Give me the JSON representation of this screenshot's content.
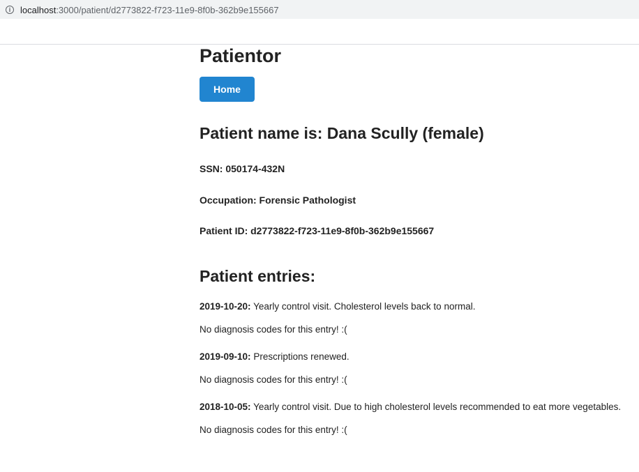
{
  "browser": {
    "url_host": "localhost",
    "url_path": ":3000/patient/d2773822-f723-11e9-8f0b-362b9e155667",
    "info_icon": "info-icon"
  },
  "app": {
    "title": "Patientor",
    "home_button": "Home",
    "accent_color": "#2185d0"
  },
  "patient": {
    "heading": "Patient name is: Dana Scully (female)",
    "ssn": "SSN: 050174-432N",
    "occupation": "Occupation: Forensic Pathologist",
    "id": "Patient ID: d2773822-f723-11e9-8f0b-362b9e155667"
  },
  "entries": {
    "heading": "Patient entries:",
    "items": [
      {
        "date": "2019-10-20:",
        "description": " Yearly control visit. Cholesterol levels back to normal.",
        "diagnosis": "No diagnosis codes for this entry! :("
      },
      {
        "date": "2019-09-10:",
        "description": " Prescriptions renewed.",
        "diagnosis": "No diagnosis codes for this entry! :("
      },
      {
        "date": "2018-10-05:",
        "description": " Yearly control visit. Due to high cholesterol levels recommended to eat more vegetables.",
        "diagnosis": "No diagnosis codes for this entry! :("
      }
    ]
  }
}
